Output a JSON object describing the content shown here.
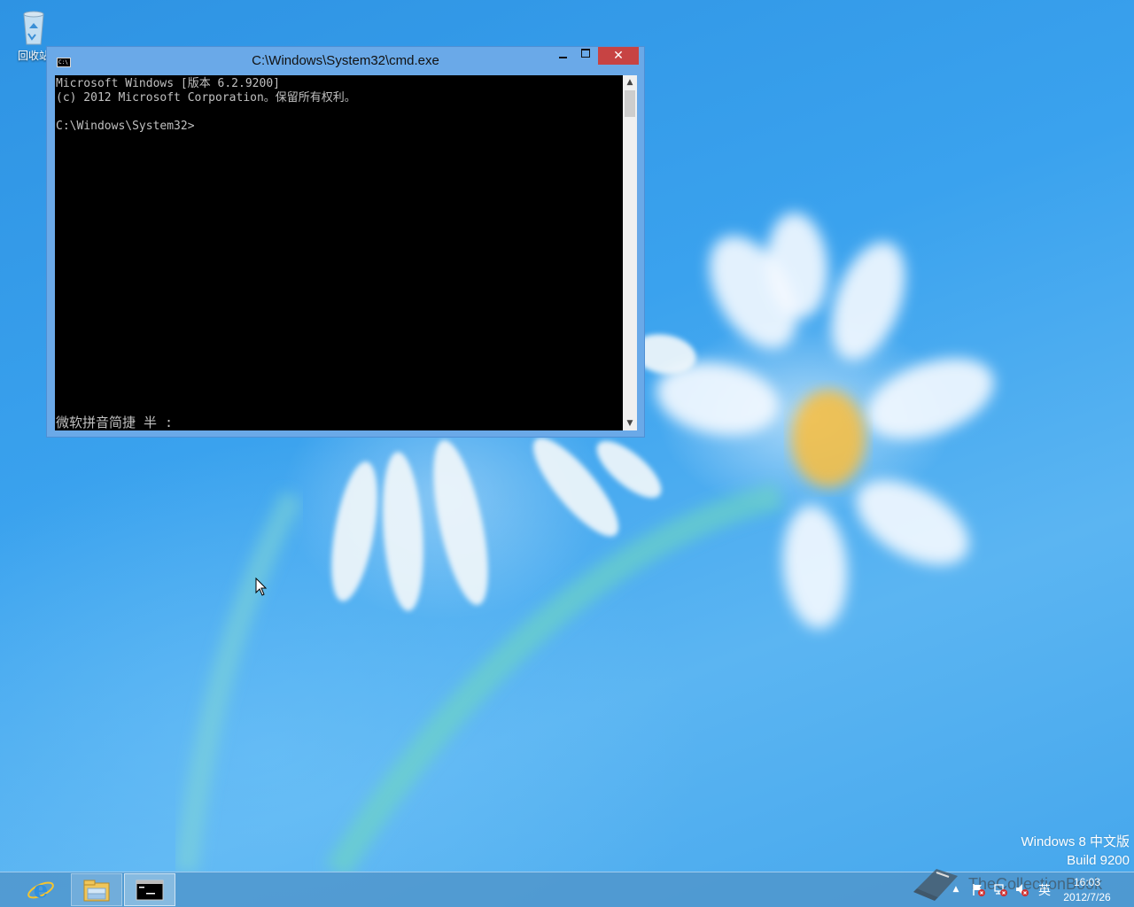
{
  "desktop": {
    "recycle_bin_label": "回收站"
  },
  "window": {
    "title": "C:\\Windows\\System32\\cmd.exe",
    "close_glyph": "✕",
    "icon_text": "C:\\"
  },
  "console": {
    "lines": [
      "Microsoft Windows [版本 6.2.9200]",
      "(c) 2012 Microsoft Corporation。保留所有权利。",
      "",
      "C:\\Windows\\System32>"
    ],
    "ime_status": "微软拼音简捷 半 :"
  },
  "watermark": {
    "edition": "Windows 8 中文版",
    "build": "Build 9200"
  },
  "taskbar": {
    "pinned": [
      "internet-explorer",
      "file-explorer",
      "command-prompt"
    ],
    "active": "command-prompt"
  },
  "tray": {
    "overlay_text": "TheCollectionBook",
    "ime_indicator": "英",
    "chevron": "▲"
  },
  "clock": {
    "time": "16:03",
    "date": "2012/7/26"
  }
}
